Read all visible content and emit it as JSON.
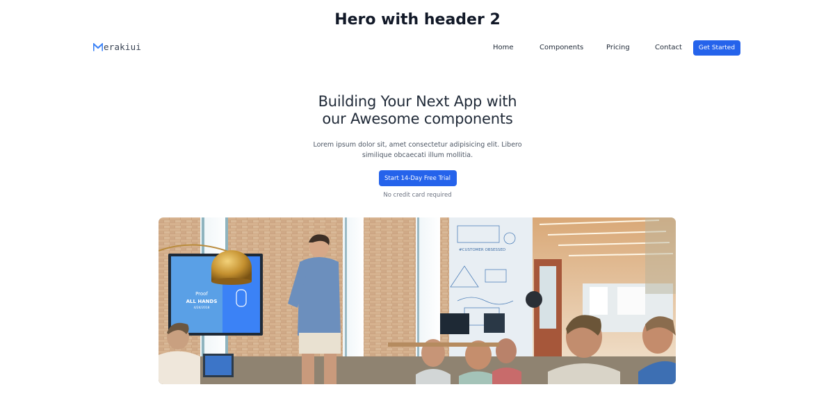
{
  "page": {
    "heading": "Hero with header 2"
  },
  "header": {
    "logo_text": "erakiui",
    "nav": [
      {
        "label": "Home"
      },
      {
        "label": "Components"
      },
      {
        "label": "Pricing"
      },
      {
        "label": "Contact"
      }
    ],
    "cta_label": "Get Started"
  },
  "hero": {
    "title_line1": "Building Your Next App with",
    "title_line2": "our Awesome components",
    "description": "Lorem ipsum dolor sit, amet consectetur adipisicing elit. Libero similique obcaecati illum mollitia.",
    "button_label": "Start 14-Day Free Trial",
    "note": "No credit card required"
  },
  "image": {
    "screen_line1": "Proof",
    "screen_line2": "ALL HANDS",
    "screen_line3": "4/24/2018",
    "whiteboard_caption": "#CUSTOMER OBSESSED"
  },
  "colors": {
    "primary": "#2563eb",
    "heading": "#111827",
    "text": "#1f2937",
    "muted": "#6b7280"
  }
}
